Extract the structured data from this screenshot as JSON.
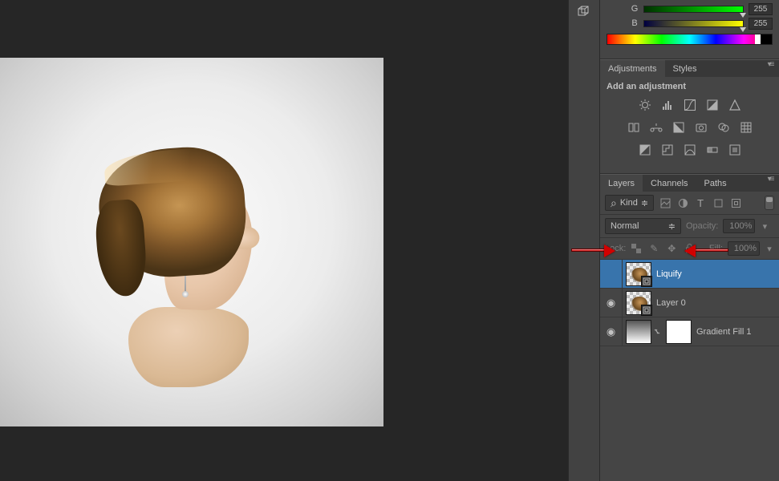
{
  "color": {
    "g_label": "G",
    "b_label": "B",
    "g_value": "255",
    "b_value": "255"
  },
  "adjustments": {
    "tab_adjustments": "Adjustments",
    "tab_styles": "Styles",
    "title": "Add an adjustment"
  },
  "layers": {
    "tab_layers": "Layers",
    "tab_channels": "Channels",
    "tab_paths": "Paths",
    "filter_kind": "Kind",
    "blend_mode": "Normal",
    "opacity_label": "Opacity:",
    "opacity_value": "100%",
    "lock_label": "Lock:",
    "fill_label": "Fill:",
    "fill_value": "100%",
    "items": [
      {
        "name": "Liquify"
      },
      {
        "name": "Layer 0"
      },
      {
        "name": "Gradient Fill 1"
      }
    ]
  }
}
